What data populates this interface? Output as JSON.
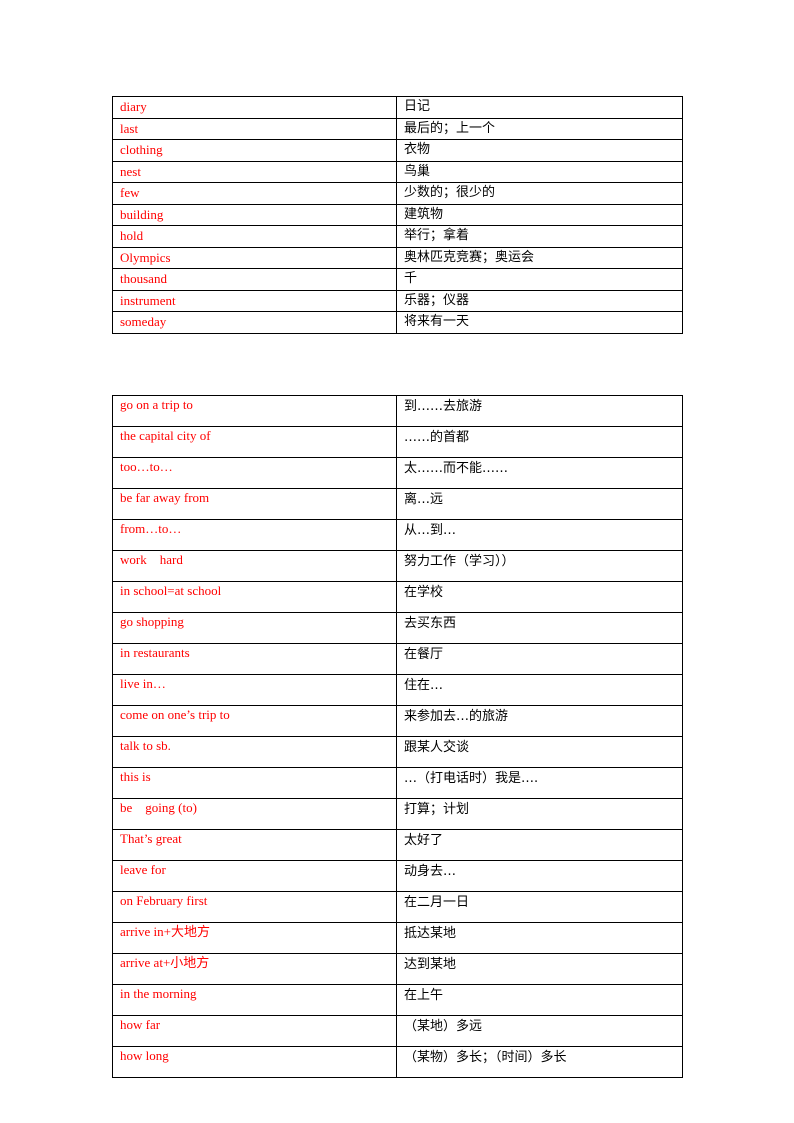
{
  "colors": {
    "english_text": "#ff0000",
    "chinese_text": "#000000",
    "border": "#000000"
  },
  "word_table": {
    "rows": [
      {
        "en": "diary",
        "zh": "日记"
      },
      {
        "en": "last",
        "zh": "最后的；上一个"
      },
      {
        "en": "clothing",
        "zh": "衣物"
      },
      {
        "en": "nest",
        "zh": "鸟巢"
      },
      {
        "en": "few",
        "zh": "少数的；很少的"
      },
      {
        "en": "building",
        "zh": "建筑物"
      },
      {
        "en": "hold",
        "zh": "举行；拿着"
      },
      {
        "en": "Olympics",
        "zh": "奥林匹克竞赛；奥运会"
      },
      {
        "en": "thousand",
        "zh": "千"
      },
      {
        "en": "instrument",
        "zh": "乐器；仪器"
      },
      {
        "en": "someday",
        "zh": "将来有一天"
      }
    ]
  },
  "phrase_table": {
    "rows": [
      {
        "en": "go on a trip to",
        "zh": "到……去旅游"
      },
      {
        "en": "the capital city of",
        "zh": "……的首都"
      },
      {
        "en": "too…to…",
        "zh": "太……而不能……"
      },
      {
        "en": "be far away from",
        "zh": "离…远"
      },
      {
        "en": "from…to…",
        "zh": "从…到…"
      },
      {
        "en": "work    hard",
        "zh": "努力工作（学习））"
      },
      {
        "en": "in school=at school",
        "zh": "在学校"
      },
      {
        "en": "go shopping",
        "zh": "去买东西"
      },
      {
        "en": "in restaurants",
        "zh": "在餐厅"
      },
      {
        "en": "live in…",
        "zh": "住在…"
      },
      {
        "en": "come on one’s trip to",
        "zh": "来参加去…的旅游"
      },
      {
        "en": "talk to sb.",
        "zh": "跟某人交谈"
      },
      {
        "en": "this is",
        "zh": "…（打电话时）我是…."
      },
      {
        "en": "be    going (to)",
        "zh": "打算；计划"
      },
      {
        "en": "That’s great",
        "zh": "太好了"
      },
      {
        "en": "leave for",
        "zh": "动身去…"
      },
      {
        "en": "on February first",
        "zh": "在二月一日"
      },
      {
        "en": "arrive in+大地方",
        "zh": "抵达某地"
      },
      {
        "en": "arrive at+小地方",
        "zh": "达到某地"
      },
      {
        "en": "in the morning",
        "zh": "在上午"
      },
      {
        "en": "how far",
        "zh": "（某地）多远"
      },
      {
        "en": "how long",
        "zh": "（某物）多长；（时间）多长"
      }
    ]
  }
}
